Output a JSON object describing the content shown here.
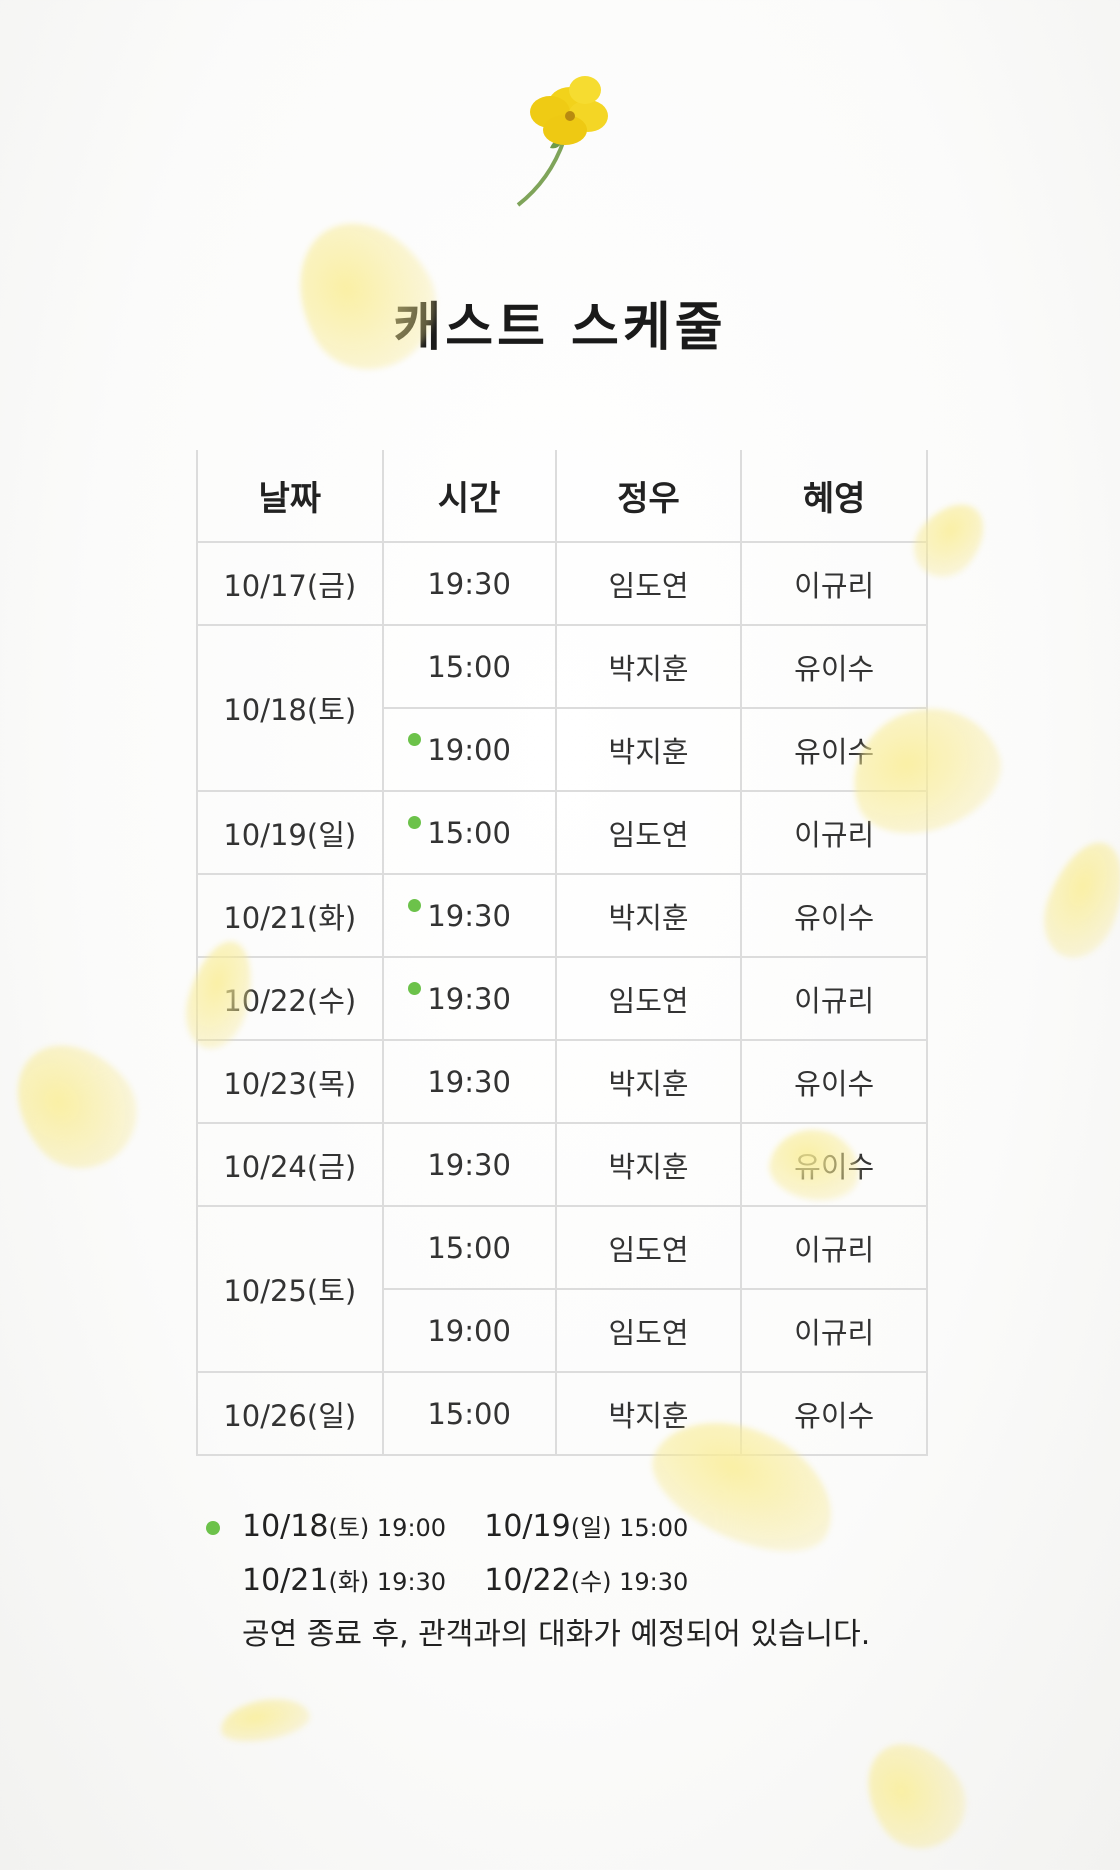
{
  "page_title": "캐스트 스케줄",
  "table": {
    "headers": [
      "날짜",
      "시간",
      "정우",
      "혜영"
    ],
    "rows": [
      {
        "date": "10/17(금)",
        "time": "19:30",
        "jungwoo": "임도연",
        "hyeyoung": "이규리",
        "dot": false
      },
      {
        "date": "10/18(토)",
        "time": "15:00",
        "jungwoo": "박지훈",
        "hyeyoung": "유이수",
        "dot": false
      },
      {
        "date": "",
        "time": "19:00",
        "jungwoo": "박지훈",
        "hyeyoung": "유이수",
        "dot": true
      },
      {
        "date": "10/19(일)",
        "time": "15:00",
        "jungwoo": "임도연",
        "hyeyoung": "이규리",
        "dot": true
      },
      {
        "date": "10/21(화)",
        "time": "19:30",
        "jungwoo": "박지훈",
        "hyeyoung": "유이수",
        "dot": true
      },
      {
        "date": "10/22(수)",
        "time": "19:30",
        "jungwoo": "임도연",
        "hyeyoung": "이규리",
        "dot": true
      },
      {
        "date": "10/23(목)",
        "time": "19:30",
        "jungwoo": "박지훈",
        "hyeyoung": "유이수",
        "dot": false
      },
      {
        "date": "10/24(금)",
        "time": "19:30",
        "jungwoo": "박지훈",
        "hyeyoung": "유이수",
        "dot": false
      },
      {
        "date": "10/25(토)",
        "time": "15:00",
        "jungwoo": "임도연",
        "hyeyoung": "이규리",
        "dot": false
      },
      {
        "date": "",
        "time": "19:00",
        "jungwoo": "임도연",
        "hyeyoung": "이규리",
        "dot": false
      },
      {
        "date": "10/26(일)",
        "time": "15:00",
        "jungwoo": "박지훈",
        "hyeyoung": "유이수",
        "dot": false
      }
    ]
  },
  "notes": {
    "line1": [
      {
        "date": "10/18",
        "day": "(토)",
        "time": " 19:00"
      },
      {
        "date": "10/19",
        "day": "(일)",
        "time": " 15:00"
      }
    ],
    "line2": [
      {
        "date": "10/21",
        "day": "(화)",
        "time": " 19:30"
      },
      {
        "date": "10/22",
        "day": "(수)",
        "time": " 19:30"
      }
    ],
    "line3": "공연 종료 후, 관객과의 대화가 예정되어 있습니다."
  },
  "colors": {
    "dot": "#6cc24a",
    "petal": "#f5e68c",
    "flower": "#f2d21b"
  }
}
